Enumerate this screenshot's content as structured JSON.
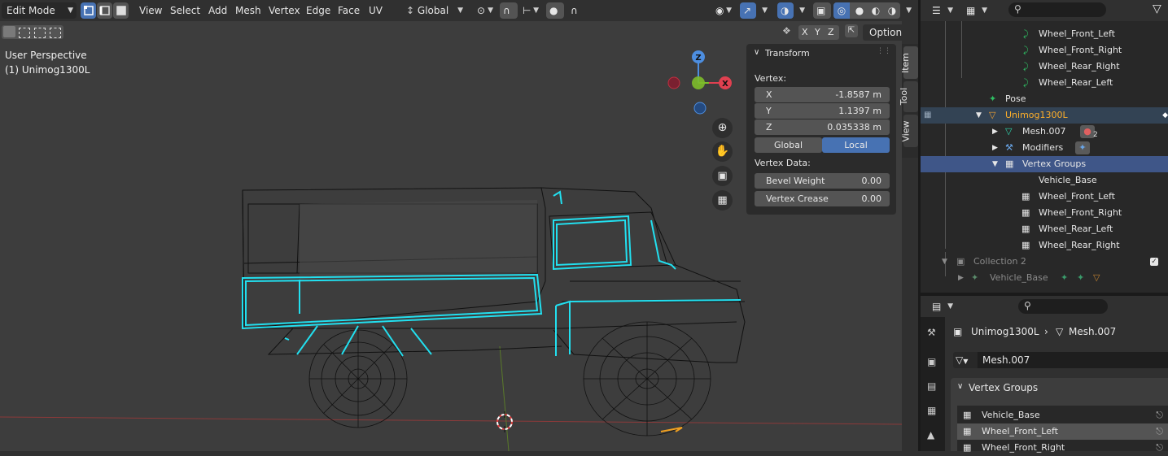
{
  "header": {
    "mode": "Edit Mode",
    "menus": [
      "View",
      "Select",
      "Add",
      "Mesh",
      "Vertex",
      "Edge",
      "Face",
      "UV"
    ],
    "orientation": "Global",
    "options": "Options",
    "axes": [
      "X",
      "Y",
      "Z"
    ]
  },
  "viewport": {
    "perspective": "User Perspective",
    "object": "(1) Unimog1300L"
  },
  "gizmo": {
    "z": "Z",
    "x": "X"
  },
  "transform_panel": {
    "title": "Transform",
    "vertex_label": "Vertex:",
    "x_label": "X",
    "x_value": "-1.8587 m",
    "y_label": "Y",
    "y_value": "1.1397 m",
    "z_label": "Z",
    "z_value": "0.035338 m",
    "global": "Global",
    "local": "Local",
    "vertex_data_label": "Vertex Data:",
    "bevel_label": "Bevel Weight",
    "bevel_value": "0.00",
    "crease_label": "Vertex Crease",
    "crease_value": "0.00"
  },
  "side_tabs": [
    "Item",
    "Tool",
    "View"
  ],
  "outliner": {
    "rows": [
      {
        "label": "Wheel_Front_Left",
        "icon": "bone-icon"
      },
      {
        "label": "Wheel_Front_Right",
        "icon": "bone-icon"
      },
      {
        "label": "Wheel_Rear_Right",
        "icon": "bone-icon"
      },
      {
        "label": "Wheel_Rear_Left",
        "icon": "bone-icon"
      },
      {
        "label": "Pose",
        "icon": "pose-icon"
      },
      {
        "label": "Unimog1300L",
        "icon": "mesh-object-icon"
      },
      {
        "label": "Mesh.007",
        "icon": "mesh-data-icon"
      },
      {
        "label": "Modifiers",
        "icon": "wrench-icon"
      },
      {
        "label": "Vertex Groups",
        "icon": "vertex-groups-icon"
      },
      {
        "label": "Vehicle_Base",
        "icon": "vertex-group-icon"
      },
      {
        "label": "Wheel_Front_Left",
        "icon": "vertex-group-icon"
      },
      {
        "label": "Wheel_Front_Right",
        "icon": "vertex-group-icon"
      },
      {
        "label": "Wheel_Rear_Left",
        "icon": "vertex-group-icon"
      },
      {
        "label": "Wheel_Rear_Right",
        "icon": "vertex-group-icon"
      },
      {
        "label": "Collection 2",
        "icon": "collection-icon"
      },
      {
        "label": "Vehicle_Base",
        "icon": "armature-icon"
      }
    ],
    "material_count": "2"
  },
  "properties": {
    "object_name": "Unimog1300L",
    "mesh_name": "Mesh.007",
    "datablock": "Mesh.007",
    "section": "Vertex Groups",
    "groups": [
      "Vehicle_Base",
      "Wheel_Front_Left",
      "Wheel_Front_Right"
    ]
  }
}
